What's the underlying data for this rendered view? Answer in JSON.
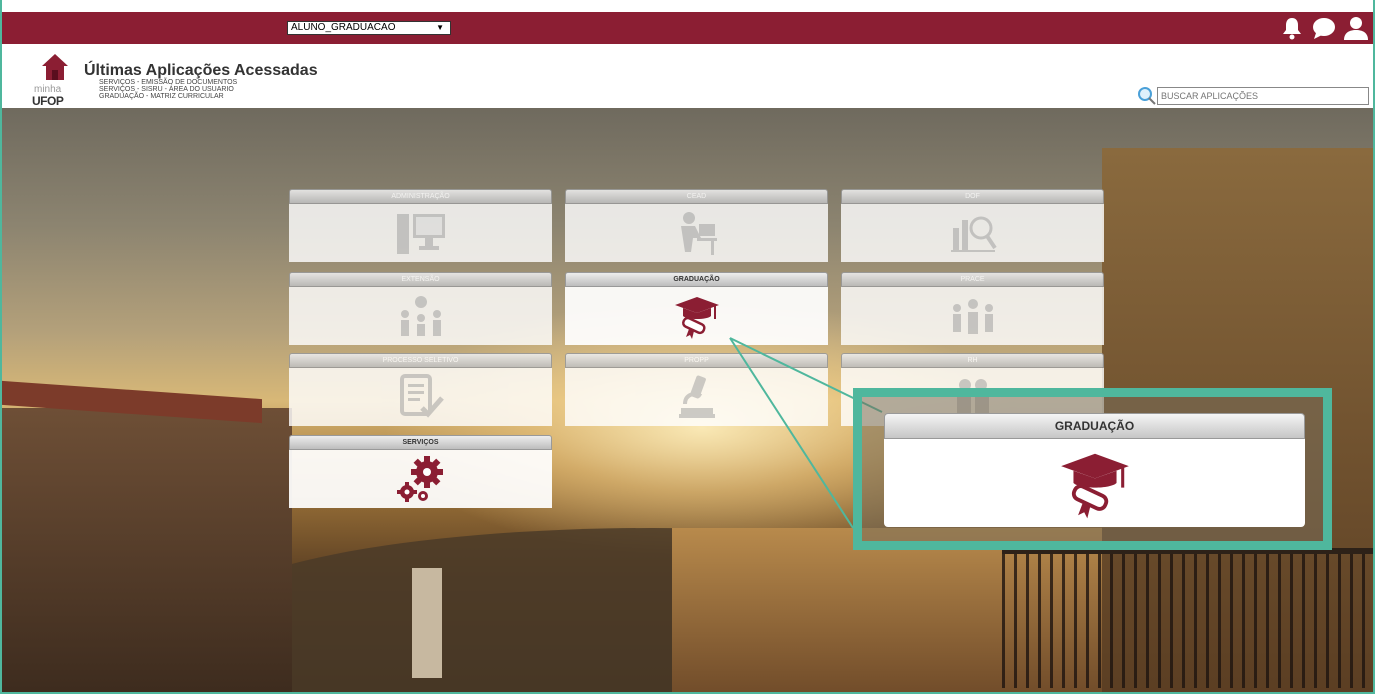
{
  "topbar": {
    "role_select_value": "ALUNO_GRADUACAO",
    "icons": [
      "bell-icon",
      "chat-icon",
      "user-icon"
    ],
    "color": "#8b1e33"
  },
  "header": {
    "logo_small": "minha",
    "logo_big": "UFOP",
    "recent_title": "Últimas Aplicações Acessadas",
    "recent_items": [
      "SERVIÇOS - EMISSÃO DE DOCUMENTOS",
      "SERVIÇOS - SISRU - ÁREA DO USUARIO",
      "GRADUAÇÃO - MATRIZ CURRICULAR"
    ],
    "search_placeholder": "BUSCAR APLICAÇÕES"
  },
  "tiles": [
    {
      "label": "ADMINISTRAÇÃO",
      "icon": "computer-icon",
      "active": false
    },
    {
      "label": "CEAD",
      "icon": "student-desk-icon",
      "active": false
    },
    {
      "label": "DOF",
      "icon": "finance-chart-icon",
      "active": false
    },
    {
      "label": "EXTENSÃO",
      "icon": "community-icon",
      "active": false
    },
    {
      "label": "GRADUAÇÃO",
      "icon": "graduation-cap-icon",
      "active": true
    },
    {
      "label": "PRACE",
      "icon": "people-icon",
      "active": false
    },
    {
      "label": "PROCESSO SELETIVO",
      "icon": "checklist-icon",
      "active": false
    },
    {
      "label": "PROPP",
      "icon": "microscope-icon",
      "active": false
    },
    {
      "label": "RH",
      "icon": "people-icon",
      "active": false
    },
    {
      "label": "SERVIÇOS",
      "icon": "gears-icon",
      "active": true
    }
  ],
  "callout": {
    "label": "GRADUAÇÃO",
    "icon": "graduation-cap-icon",
    "border_color": "#4fb79d"
  },
  "colors": {
    "accent": "#8b1e33",
    "highlight": "#4fb79d",
    "icon_faded": "#c8c8c8"
  }
}
